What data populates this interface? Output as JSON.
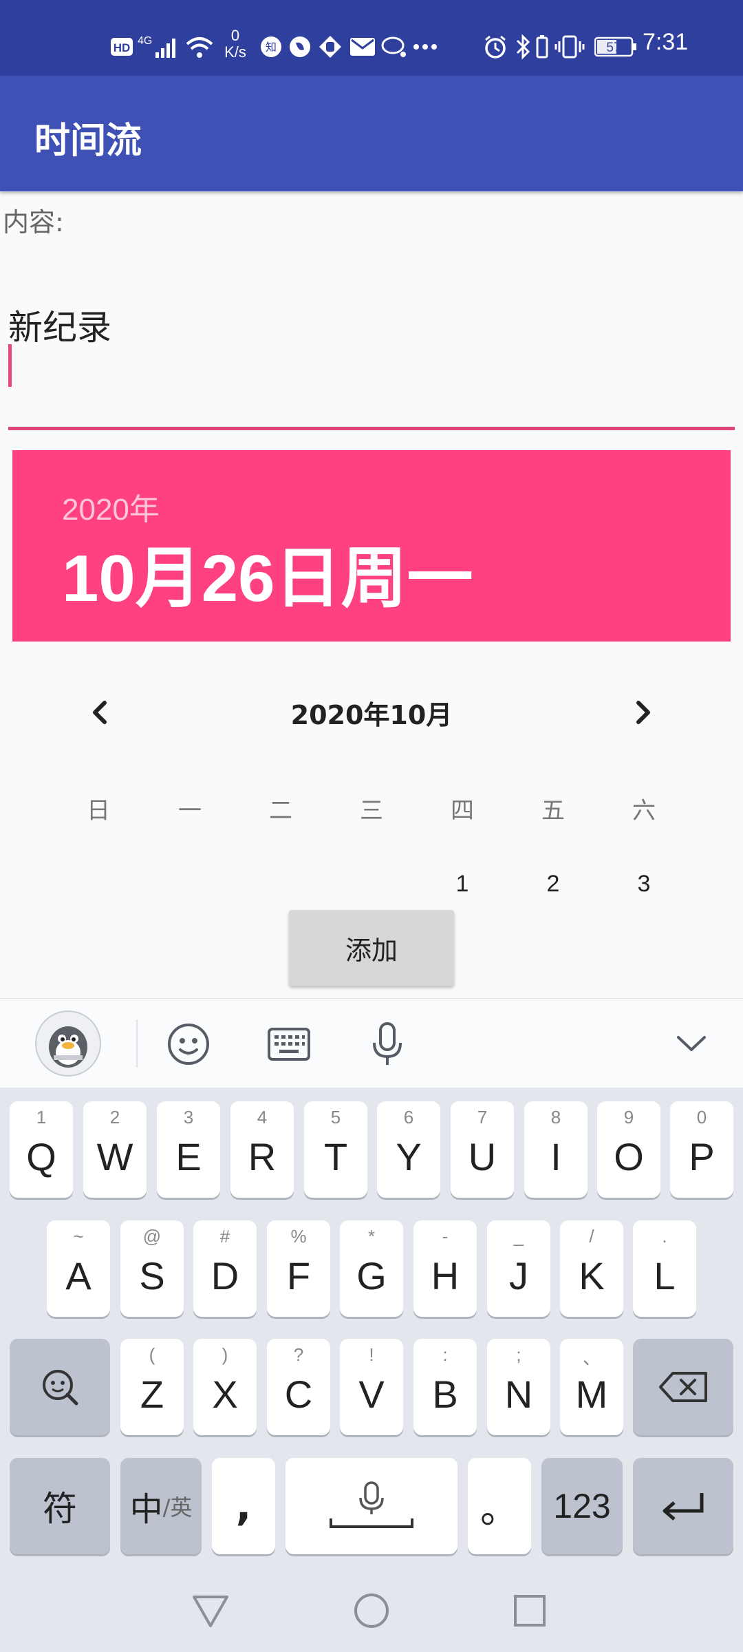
{
  "status_bar": {
    "hd": "HD",
    "network": "4G",
    "speed_value": "0",
    "speed_unit": "K/s",
    "battery": "57",
    "time": "7:31"
  },
  "app_bar": {
    "title": "时间流"
  },
  "form": {
    "content_label": "内容:",
    "input_value": "新纪录"
  },
  "date_picker": {
    "year": "2020年",
    "selected_date": "10月26日周一",
    "month_label": "2020年10月",
    "weekdays": [
      "日",
      "一",
      "二",
      "三",
      "四",
      "五",
      "六"
    ],
    "first_row_days": [
      "1",
      "2",
      "3"
    ]
  },
  "add_button": {
    "label": "添加"
  },
  "keyboard": {
    "row1": [
      {
        "main": "Q",
        "sub": "1"
      },
      {
        "main": "W",
        "sub": "2"
      },
      {
        "main": "E",
        "sub": "3"
      },
      {
        "main": "R",
        "sub": "4"
      },
      {
        "main": "T",
        "sub": "5"
      },
      {
        "main": "Y",
        "sub": "6"
      },
      {
        "main": "U",
        "sub": "7"
      },
      {
        "main": "I",
        "sub": "8"
      },
      {
        "main": "O",
        "sub": "9"
      },
      {
        "main": "P",
        "sub": "0"
      }
    ],
    "row2": [
      {
        "main": "A",
        "sub": "~"
      },
      {
        "main": "S",
        "sub": "@"
      },
      {
        "main": "D",
        "sub": "#"
      },
      {
        "main": "F",
        "sub": "%"
      },
      {
        "main": "G",
        "sub": "*"
      },
      {
        "main": "H",
        "sub": "-"
      },
      {
        "main": "J",
        "sub": "_"
      },
      {
        "main": "K",
        "sub": "/"
      },
      {
        "main": "L",
        "sub": "."
      }
    ],
    "row3": [
      {
        "main": "Z",
        "sub": "("
      },
      {
        "main": "X",
        "sub": ")"
      },
      {
        "main": "C",
        "sub": "?"
      },
      {
        "main": "V",
        "sub": "!"
      },
      {
        "main": "B",
        "sub": ":"
      },
      {
        "main": "N",
        "sub": ";"
      },
      {
        "main": "M",
        "sub": "、"
      }
    ],
    "symbol_key": "符",
    "lang_key_main": "中",
    "lang_key_sub": "/英",
    "comma_key": ",",
    "period_key": "。",
    "num_key": "123"
  },
  "colors": {
    "status_bar": "#2f3f9e",
    "app_bar": "#3f51b5",
    "accent": "#ff4081"
  },
  "icons": {
    "toolbar": [
      "qq-penguin-icon",
      "emoji-icon",
      "keyboard-icon",
      "microphone-icon",
      "chevron-down-icon"
    ],
    "nav": [
      "back-triangle-icon",
      "home-circle-icon",
      "recents-square-icon"
    ]
  }
}
